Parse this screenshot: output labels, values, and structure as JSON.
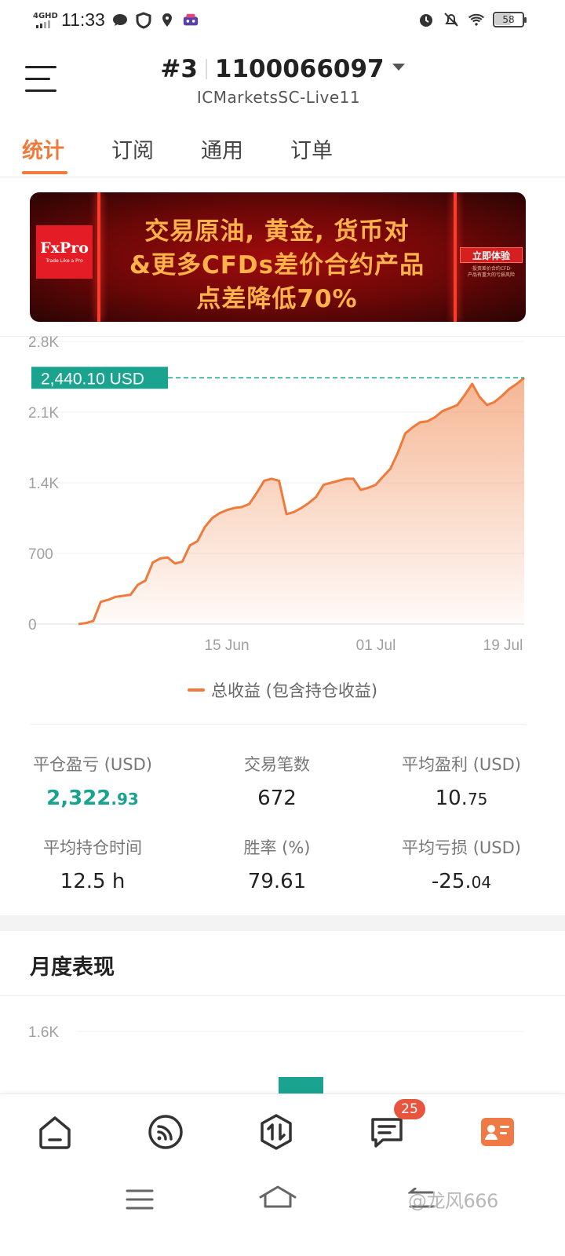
{
  "status_bar": {
    "network": "4GHD",
    "time": "11:33",
    "battery": "58",
    "left_icons": [
      "chat-bubble-icon",
      "shield-icon",
      "location-pin-icon",
      "app-badge-icon"
    ],
    "right_icons": [
      "alarm-icon",
      "mute-bell-icon",
      "wifi-icon",
      "battery-icon"
    ]
  },
  "header": {
    "account_prefix": "#3",
    "account_number": "1100066097",
    "server": "ICMarketsSC-Live11"
  },
  "tabs": [
    {
      "label": "统计",
      "active": true
    },
    {
      "label": "订阅",
      "active": false
    },
    {
      "label": "通用",
      "active": false
    },
    {
      "label": "订单",
      "active": false
    }
  ],
  "banner": {
    "brand": "FxPro",
    "brand_tagline": "Trade Like a Pro",
    "line1": "交易原油, 黄金, 货币对",
    "line2": "&更多CFDs差价合约产品",
    "line3": "点差降低70%",
    "cta": "立即体验",
    "cta_sub": "·投资差价合约CFD·\n产品有重大的亏损风险",
    "colors": {
      "accent": "#ffb24a",
      "background": "#7a0909",
      "logo": "#e31c25"
    }
  },
  "chart_data": {
    "type": "area",
    "y_ticks": [
      "2.8K",
      "2.1K",
      "1.4K",
      "700",
      "0"
    ],
    "ylim": [
      0,
      2800
    ],
    "x_ticks": [
      "15 Jun",
      "01 Jul",
      "19 Jul"
    ],
    "current_value_label": "2,440.10 USD",
    "current_value": 2440.1,
    "legend": "总收益 (包含持仓收益)",
    "colors": {
      "line": "#ee7a3c",
      "fill": "#f9c2a6",
      "marker": "#1aa38e"
    },
    "series": [
      {
        "name": "总收益 (包含持仓收益)",
        "values": [
          0,
          10,
          30,
          220,
          240,
          270,
          280,
          290,
          390,
          430,
          610,
          650,
          660,
          600,
          620,
          780,
          820,
          960,
          1050,
          1100,
          1130,
          1150,
          1160,
          1190,
          1300,
          1420,
          1440,
          1420,
          1090,
          1110,
          1150,
          1200,
          1260,
          1380,
          1400,
          1420,
          1440,
          1440,
          1330,
          1350,
          1380,
          1460,
          1540,
          1700,
          1890,
          1950,
          2000,
          2010,
          2050,
          2110,
          2140,
          2170,
          2270,
          2380,
          2250,
          2170,
          2200,
          2260,
          2330,
          2380,
          2440
        ]
      }
    ]
  },
  "stats": [
    {
      "label": "平仓盈亏 (USD)",
      "int": "2,322",
      "dec": ".93",
      "highlight": true
    },
    {
      "label": "交易笔数",
      "int": "672",
      "dec": "",
      "highlight": false
    },
    {
      "label": "平均盈利 (USD)",
      "int": "10.",
      "dec": "75",
      "highlight": false
    },
    {
      "label": "平均持仓时间",
      "int": "12.5 h",
      "dec": "",
      "highlight": false
    },
    {
      "label": "胜率 (%)",
      "int": "79.61",
      "dec": "",
      "highlight": false
    },
    {
      "label": "平均亏损 (USD)",
      "int": "-25.",
      "dec": "04",
      "highlight": false
    }
  ],
  "monthly": {
    "title": "月度表现",
    "y_tick_top": "1.6K",
    "bar_color": "#1aa38e"
  },
  "bottom_nav": [
    {
      "icon": "home-icon"
    },
    {
      "icon": "signal-feed-icon"
    },
    {
      "icon": "trade-icon"
    },
    {
      "icon": "messages-icon",
      "badge": "25"
    },
    {
      "icon": "profile-card-icon",
      "active": true
    }
  ],
  "watermark": "@龙风666"
}
